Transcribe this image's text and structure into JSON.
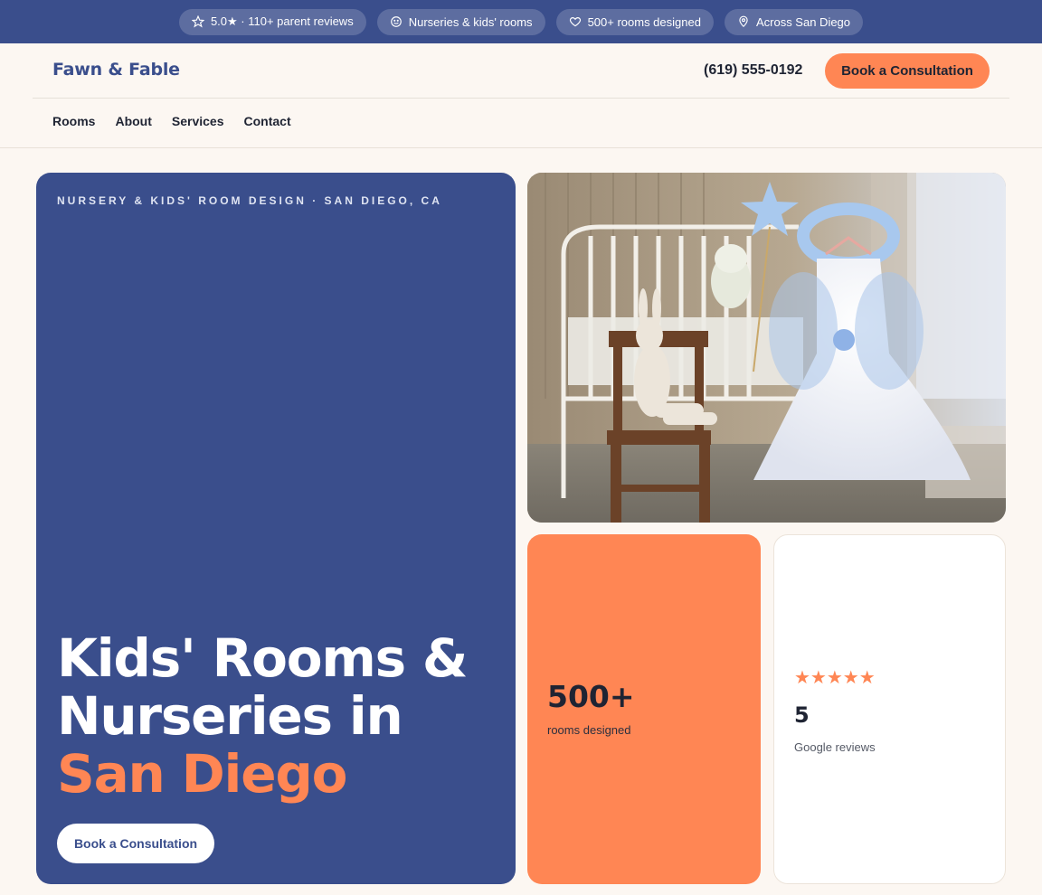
{
  "topbar": {
    "badges": [
      {
        "icon": "star-outline-icon",
        "label": "5.0★ · 110+ parent reviews"
      },
      {
        "icon": "smile-icon",
        "label": "Nurseries & kids' rooms"
      },
      {
        "icon": "heart-icon",
        "label": "500+ rooms designed"
      },
      {
        "icon": "map-pin-icon",
        "label": "Across San Diego"
      }
    ]
  },
  "header": {
    "logo": "Fawn & Fable",
    "phone": "(619) 555-0192",
    "cta": "Book a Consultation",
    "nav": [
      "Rooms",
      "About",
      "Services",
      "Contact"
    ]
  },
  "hero": {
    "eyebrow": "NURSERY & KIDS' ROOM DESIGN · SAN DIEGO, CA",
    "title_main": "Kids' Rooms & Nurseries in ",
    "title_accent": "San Diego",
    "cta": "Book a Consultation"
  },
  "stats": {
    "rooms_value": "500+",
    "rooms_label": "rooms designed",
    "stars": "★★★★★",
    "rating_value": "5",
    "rating_label": "Google reviews"
  },
  "colors": {
    "brand_navy": "#3a4e8c",
    "accent_orange": "#ff8654",
    "page_bg": "#fcf7f2"
  }
}
